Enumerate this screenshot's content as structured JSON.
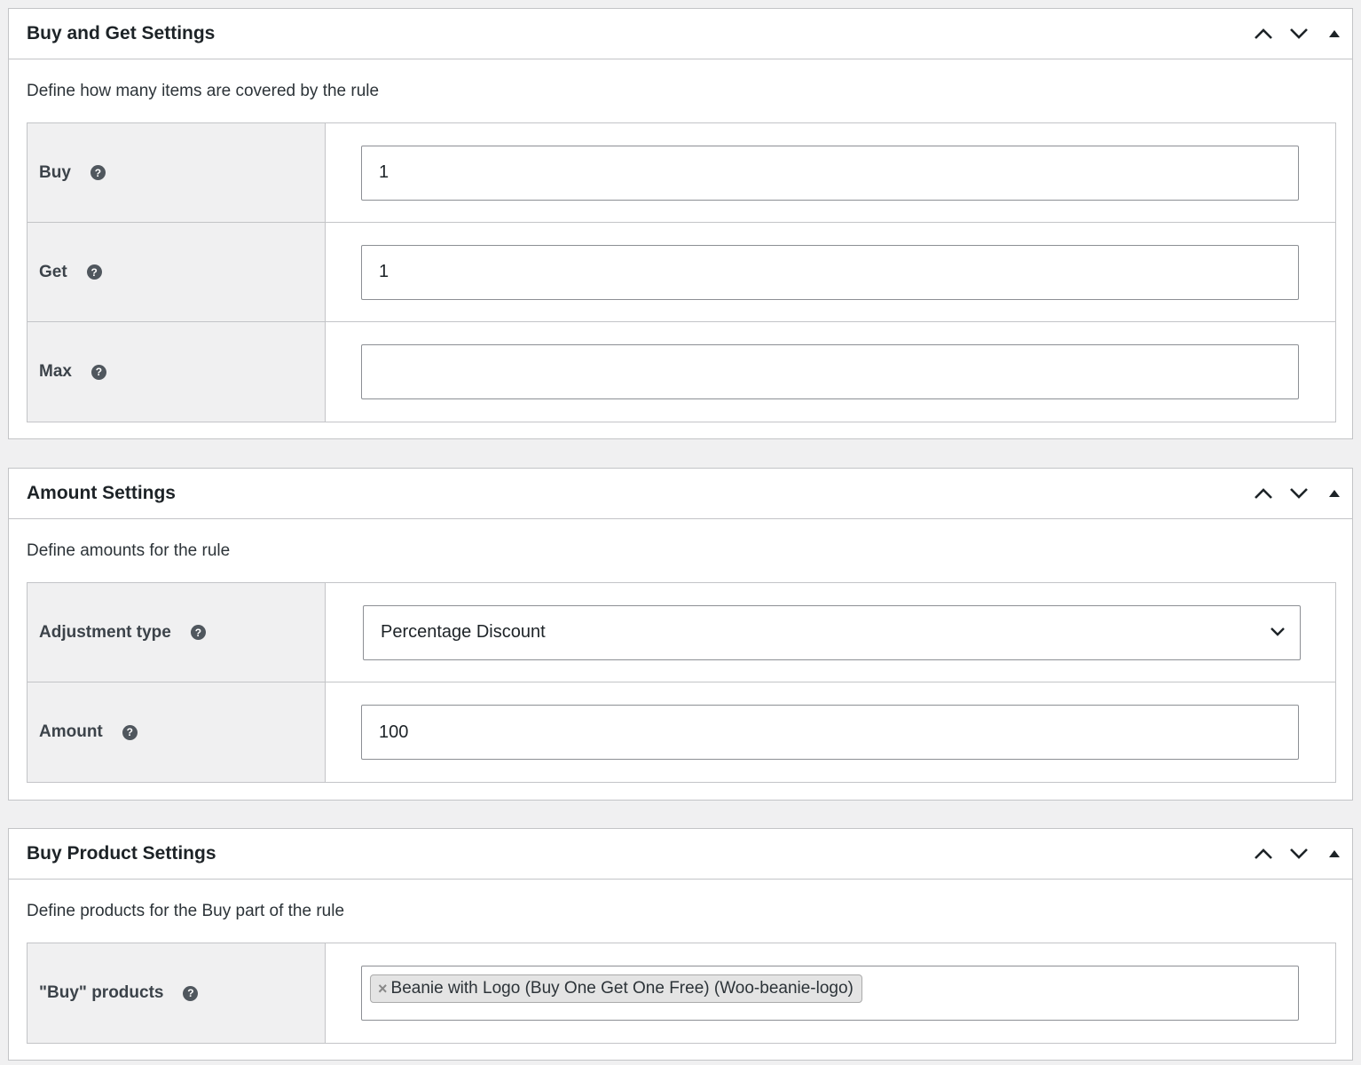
{
  "boxes": [
    {
      "title": "Buy and Get Settings",
      "description": "Define how many items are covered by the rule",
      "fields": [
        {
          "label": "Buy",
          "value": "1"
        },
        {
          "label": "Get",
          "value": "1"
        },
        {
          "label": "Max",
          "value": ""
        }
      ]
    },
    {
      "title": "Amount Settings",
      "description": "Define amounts for the rule",
      "fields": [
        {
          "label": "Adjustment type",
          "selected": "Percentage Discount"
        },
        {
          "label": "Amount",
          "value": "100"
        }
      ]
    },
    {
      "title": "Buy Product Settings",
      "description": "Define products for the Buy part of the rule",
      "fields": [
        {
          "label": "\"Buy\" products",
          "chips": [
            "Beanie with Logo (Buy One Get One Free) (Woo-beanie-logo)"
          ]
        }
      ]
    }
  ],
  "icons": {
    "help": "help-icon",
    "move_up": "chevron-up-icon",
    "move_down": "chevron-down-icon",
    "toggle": "triangle-up-icon",
    "select_arrow": "chevron-down-icon",
    "chip_remove": "close-icon",
    "help_glyph": "?",
    "remove_glyph": "×"
  },
  "colors": {
    "page_background": "#f0f0f1",
    "panel_background": "#ffffff",
    "border": "#c3c4c7",
    "label_cell_background": "#f0f0f1",
    "text": "#1d2327",
    "help_icon": "#50575e"
  }
}
